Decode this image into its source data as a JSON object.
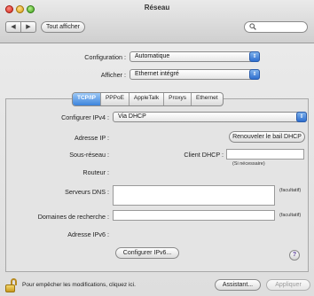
{
  "window": {
    "title": "Réseau"
  },
  "toolbar": {
    "back": "◀",
    "forward": "▶",
    "show_all": "Tout afficher",
    "search_placeholder": ""
  },
  "top": {
    "configuration_label": "Configuration :",
    "configuration_value": "Automatique",
    "afficher_label": "Afficher :",
    "afficher_value": "Ethernet intégré"
  },
  "tabs": [
    "TCP/IP",
    "PPPoE",
    "AppleTalk",
    "Proxys",
    "Ethernet"
  ],
  "tcpip": {
    "configurer_ipv4_label": "Configurer IPv4 :",
    "configurer_ipv4_value": "Via DHCP",
    "adresse_ip_label": "Adresse IP :",
    "renew_button": "Renouveler le bail DHCP",
    "sous_reseau_label": "Sous-réseau :",
    "client_dhcp_label": "Client DHCP :",
    "client_dhcp_value": "",
    "si_necessaire": "(Si nécessaire)",
    "routeur_label": "Routeur :",
    "serveurs_dns_label": "Serveurs DNS :",
    "facultatif_1": "(facultatif)",
    "domaines_label": "Domaines de recherche :",
    "facultatif_2": "(facultatif)",
    "adresse_ipv6_label": "Adresse IPv6 :",
    "configurer_ipv6_button": "Configurer IPv6..."
  },
  "help": "?",
  "footer": {
    "lock_text": "Pour empêcher les modifications, cliquez ici.",
    "assistant_button": "Assistant...",
    "appliquer_button": "Appliquer"
  }
}
